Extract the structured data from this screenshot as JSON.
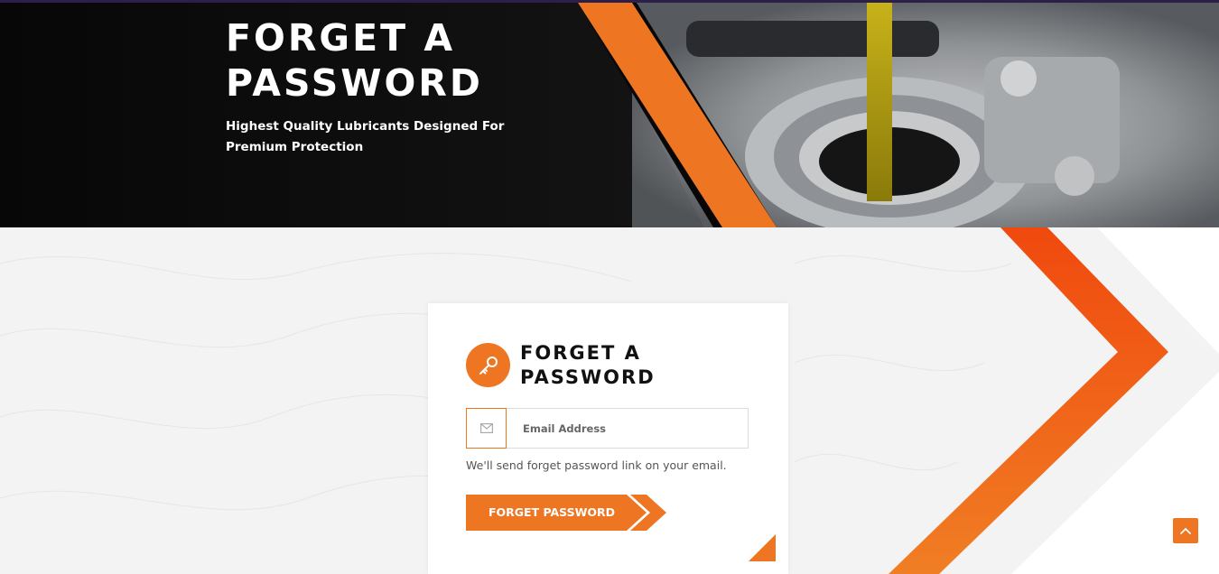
{
  "hero": {
    "title": "FORGET A PASSWORD",
    "subtitle": "Highest Quality Lubricants Designed For Premium Protection"
  },
  "card": {
    "icon": "key-icon",
    "title": "FORGET A PASSWORD",
    "email": {
      "icon": "envelope-icon",
      "placeholder": "Email Address",
      "value": ""
    },
    "helper_text": "We'll send forget password link on your email.",
    "submit_label": "FORGET PASSWORD"
  },
  "scroll_top": {
    "icon": "chevron-up-icon"
  },
  "colors": {
    "accent": "#ee7623",
    "accent_red": "#f04e0f",
    "hero_bg": "#050505",
    "content_bg": "#f3f3f3"
  }
}
